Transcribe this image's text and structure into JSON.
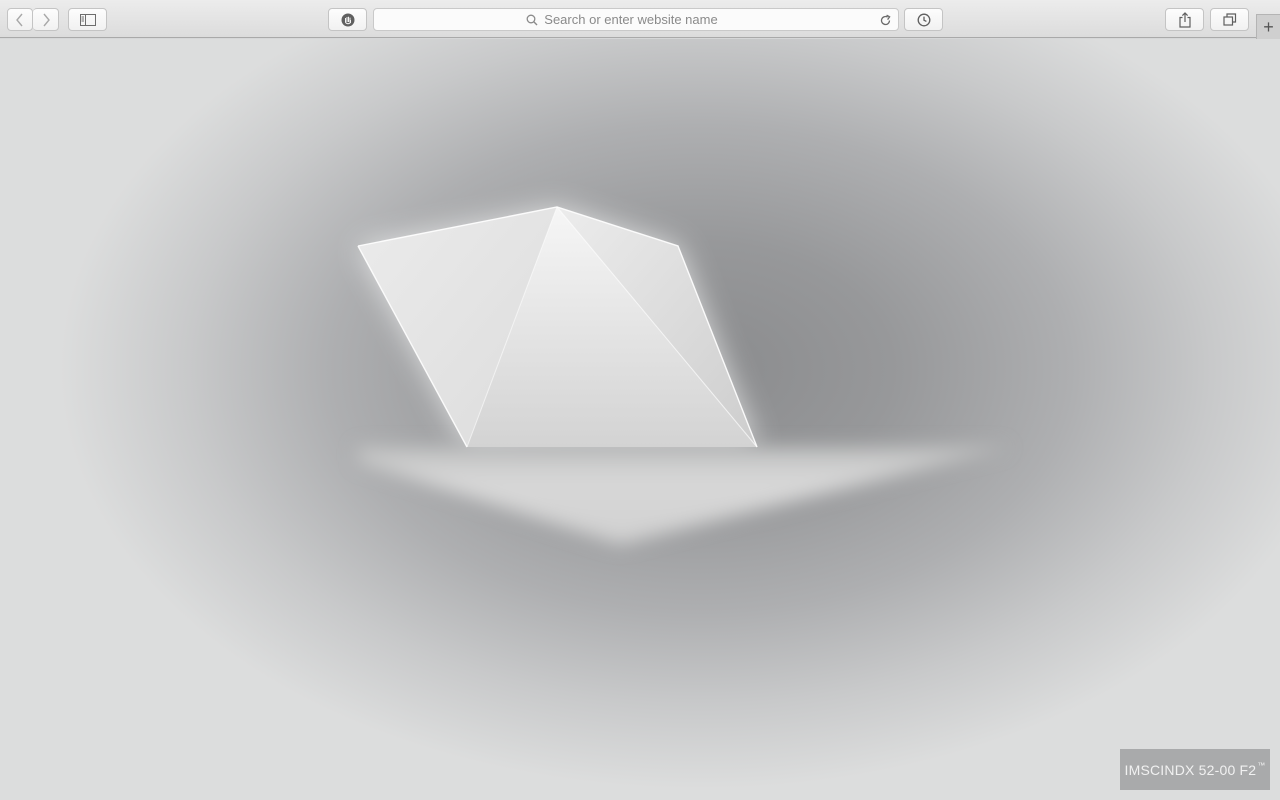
{
  "browser": {
    "address_placeholder": "Search or enter website name",
    "new_tab_label": "+"
  },
  "page": {
    "badge_text": "IMSCINDX 52-00 F2",
    "badge_mark": "™"
  }
}
